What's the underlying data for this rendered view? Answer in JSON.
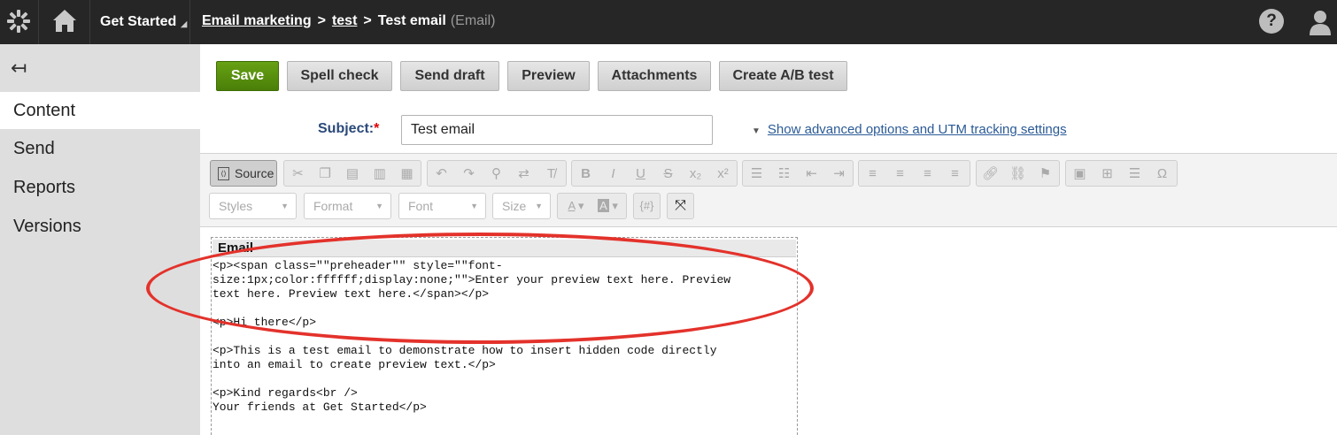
{
  "topbar": {
    "site_name": "Get Started",
    "breadcrumb": {
      "app": "Email marketing",
      "campaign": "test",
      "current": "Test email",
      "type": "(Email)"
    },
    "help_label": "?"
  },
  "sidebar": {
    "items": [
      {
        "label": "Content"
      },
      {
        "label": "Send"
      },
      {
        "label": "Reports"
      },
      {
        "label": "Versions"
      }
    ]
  },
  "actions": {
    "save": "Save",
    "spell_check": "Spell check",
    "send_draft": "Send draft",
    "preview": "Preview",
    "attachments": "Attachments",
    "create_ab": "Create A/B test"
  },
  "subject": {
    "label": "Subject:",
    "required": "*",
    "value": "Test email"
  },
  "advanced_link": "Show advanced options and UTM tracking settings",
  "editor": {
    "source_label": "Source",
    "styles": "Styles",
    "format": "Format",
    "font": "Font",
    "size": "Size",
    "macro": "{#}",
    "region_label": "Email",
    "lines": [
      "<p><span class=\"\"preheader\"\" style=\"\"font-",
      "size:1px;color:ffffff;display:none;\"\">Enter your preview text here. Preview",
      "text here. Preview text here.</span></p>",
      "<p>Hi there</p>",
      "<p>This is a test email to demonstrate how to insert hidden code directly",
      "into an email to create preview text.</p>",
      "<p>Kind regards<br />",
      "Your friends at Get Started</p>"
    ]
  },
  "colors": {
    "topbar": "#262626",
    "sidebar": "#dedede",
    "save_green": "#5a9010",
    "highlight": "#e3322b",
    "link": "#2a5a96"
  }
}
